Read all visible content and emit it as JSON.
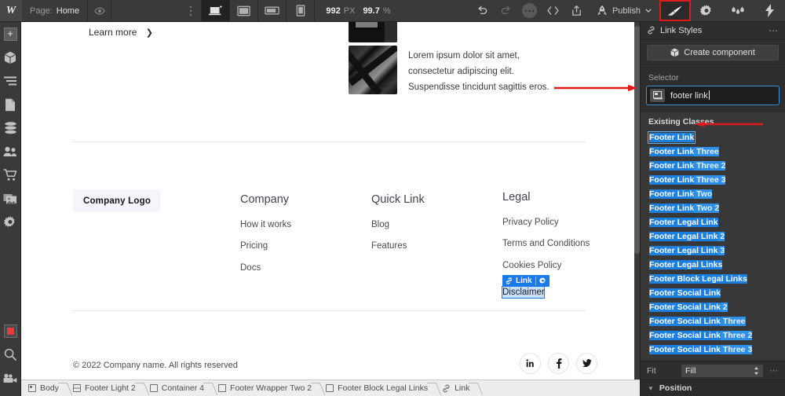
{
  "topbar": {
    "logo": "W",
    "page_label": "Page:",
    "page_name": "Home",
    "eye_icon": "eye-icon",
    "more_icon": "vertical-dots-icon",
    "devices": [
      {
        "name": "desktop-breakpoint",
        "icon": "desktop-icon",
        "active": true
      },
      {
        "name": "tablet-breakpoint",
        "icon": "tablet-icon",
        "active": false
      },
      {
        "name": "mobile-landscape-breakpoint",
        "icon": "mobile-landscape-icon",
        "active": false
      },
      {
        "name": "mobile-portrait-breakpoint",
        "icon": "mobile-portrait-icon",
        "active": false
      }
    ],
    "canvas_width": "992",
    "canvas_width_unit": "PX",
    "zoom_value": "99.7",
    "zoom_unit": "%",
    "undo_icon": "undo-icon",
    "redo_icon": "redo-icon",
    "more_round_icon": "ellipsis-icon",
    "code_icon": "code-icon",
    "export_icon": "share-icon",
    "rocket_icon": "rocket-icon",
    "publish_label": "Publish",
    "publish_caret": "chevron-down-icon",
    "panels": [
      {
        "name": "style-panel-button",
        "icon": "paintbrush-icon",
        "highlighted": true
      },
      {
        "name": "settings-panel-button",
        "icon": "gear-icon",
        "highlighted": false
      },
      {
        "name": "interactions-panel-button",
        "icon": "water-drops-icon",
        "highlighted": false
      },
      {
        "name": "lightning-panel-button",
        "icon": "lightning-icon",
        "highlighted": false
      }
    ]
  },
  "leftrail": {
    "items": [
      {
        "name": "add-elements",
        "icon": "plus-icon"
      },
      {
        "name": "components",
        "icon": "cube-icon"
      },
      {
        "name": "navigator",
        "icon": "layers-list-icon"
      },
      {
        "name": "pages",
        "icon": "page-icon"
      },
      {
        "name": "cms-collections",
        "icon": "database-icon"
      },
      {
        "name": "users",
        "icon": "users-icon"
      },
      {
        "name": "ecommerce",
        "icon": "cart-icon"
      },
      {
        "name": "assets",
        "icon": "images-icon"
      },
      {
        "name": "project-settings",
        "icon": "gear-icon"
      },
      {
        "name": "video-record",
        "icon": "record-stop-icon"
      },
      {
        "name": "search",
        "icon": "magnifier-icon"
      },
      {
        "name": "video-tutorials",
        "icon": "video-camera-icon"
      }
    ]
  },
  "canvas": {
    "learn_more": "Learn more",
    "learn_more_chevron": "chevron-right-icon",
    "lorem": "Lorem ipsum dolor sit amet, consectetur adipiscing elit. Suspendisse tincidunt sagittis eros.",
    "company_logo": "Company Logo",
    "columns": [
      {
        "name": "footer-column-company",
        "heading": "Company",
        "links": [
          "How it works",
          "Pricing",
          "Docs"
        ]
      },
      {
        "name": "footer-column-quick-link",
        "heading": "Quick Link",
        "links": [
          "Blog",
          "Features"
        ]
      },
      {
        "name": "footer-column-legal",
        "heading": "Legal",
        "links": [
          "Privacy Policy",
          "Terms and Conditions",
          "Cookies Policy"
        ]
      }
    ],
    "selected": {
      "badge_label": "Link",
      "badge_icon": "link-icon",
      "badge_gear_icon": "gear-icon",
      "text": "Disclaimer"
    },
    "copyright": "© 2022 Company name. All rights reserved",
    "socials": [
      {
        "name": "linkedin-icon",
        "glyph": "in"
      },
      {
        "name": "facebook-icon",
        "glyph": "f"
      },
      {
        "name": "twitter-icon",
        "glyph": "t"
      }
    ]
  },
  "right_panel": {
    "title": "Link Styles",
    "title_icon": "link-icon",
    "menu_icon": "ellipsis-icon",
    "create_component": "Create component",
    "create_component_icon": "cube-icon",
    "selector_label": "Selector",
    "selector_icon": "selector-tag-icon",
    "selector_value": "footer link",
    "existing_classes_title": "Existing Classes",
    "existing_classes": [
      {
        "match": "Footer Link",
        "rest": ""
      },
      {
        "match": "Footer Link",
        "rest": " Three"
      },
      {
        "match": "Footer Link",
        "rest": " Three 2"
      },
      {
        "match": "Footer Link",
        "rest": " Three 3"
      },
      {
        "match": "Footer Link",
        "rest": " Two"
      },
      {
        "match": "Footer Link",
        "rest": " Two 2"
      },
      {
        "match": "Footer Legal Link",
        "rest": ""
      },
      {
        "match": "Footer Legal Link",
        "rest": " 2"
      },
      {
        "match": "Footer Legal Link",
        "rest": " 3"
      },
      {
        "match": "Footer Legal Links",
        "rest": ""
      },
      {
        "match": "Footer Block Legal Links",
        "rest": ""
      },
      {
        "match": "Footer Social Link",
        "rest": ""
      },
      {
        "match": "Footer Social Link",
        "rest": " 2"
      },
      {
        "match": "Footer Social Link",
        "rest": " Three"
      },
      {
        "match": "Footer Social Link",
        "rest": " Three 2"
      },
      {
        "match": "Footer Social Link",
        "rest": " Three 3"
      }
    ],
    "fit_label": "Fit",
    "fit_value": "Fill",
    "fit_stepper_icon": "updown-arrows-icon",
    "fit_menu_icon": "ellipsis-icon",
    "position_label": "Position",
    "position_caret": "triangle-down-icon"
  },
  "breadcrumb": [
    {
      "label": "Body",
      "icon": "body-icon"
    },
    {
      "label": "Footer Light 2",
      "icon": "section-icon"
    },
    {
      "label": "Container 4",
      "icon": "container-icon"
    },
    {
      "label": "Footer Wrapper Two 2",
      "icon": "div-icon"
    },
    {
      "label": "Footer Block Legal Links",
      "icon": "div-icon"
    },
    {
      "label": "Link",
      "icon": "link-icon"
    }
  ],
  "annotations": {
    "arrow_color": "#e01b1b",
    "arrows": [
      {
        "name": "arrow-to-selector-field"
      },
      {
        "name": "arrow-to-first-class"
      }
    ]
  }
}
